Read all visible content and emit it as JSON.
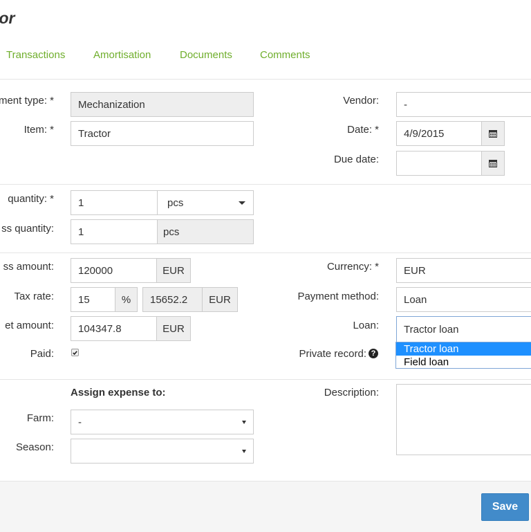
{
  "page": {
    "title": "ctor"
  },
  "tabs": [
    "Transactions",
    "Amortisation",
    "Documents",
    "Comments"
  ],
  "form": {
    "payment_type": {
      "label": "ment type: *",
      "value": "Mechanization"
    },
    "item": {
      "label": "Item: *",
      "value": "Tractor"
    },
    "vendor": {
      "label": "Vendor:",
      "value": "-"
    },
    "date": {
      "label": "Date: *",
      "value": "4/9/2015"
    },
    "due_date": {
      "label": "Due date:",
      "value": ""
    },
    "quantity": {
      "label": "quantity: *",
      "value": "1",
      "unit": "pcs"
    },
    "gross_quantity": {
      "label": "ss quantity:",
      "value": "1",
      "unit": "pcs"
    },
    "gross_amount": {
      "label": "ss amount:",
      "value": "120000",
      "currency": "EUR"
    },
    "tax_rate": {
      "label": "Tax rate:",
      "value": "15",
      "percent": "%",
      "tax_value": "15652.2",
      "currency": "EUR"
    },
    "net_amount": {
      "label": "et amount:",
      "value": "104347.8",
      "currency": "EUR"
    },
    "paid": {
      "label": "Paid:",
      "checked": true
    },
    "currency": {
      "label": "Currency: *",
      "value": "EUR"
    },
    "payment_method": {
      "label": "Payment method:",
      "value": "Loan"
    },
    "loan": {
      "label": "Loan:",
      "value": "Tractor loan",
      "options": [
        "Tractor loan",
        "Field loan"
      ],
      "highlighted": "Tractor loan"
    },
    "private_record": {
      "label": "Private record:"
    },
    "assign_heading": "Assign expense to:",
    "farm": {
      "label": "Farm:",
      "value": "-"
    },
    "season": {
      "label": "Season:",
      "value": ""
    },
    "description": {
      "label": "Description:",
      "value": ""
    }
  },
  "footer": {
    "save_label": "Save"
  },
  "colors": {
    "tab": "#6fae2c",
    "primary": "#428bca",
    "highlight": "#1e90ff"
  }
}
